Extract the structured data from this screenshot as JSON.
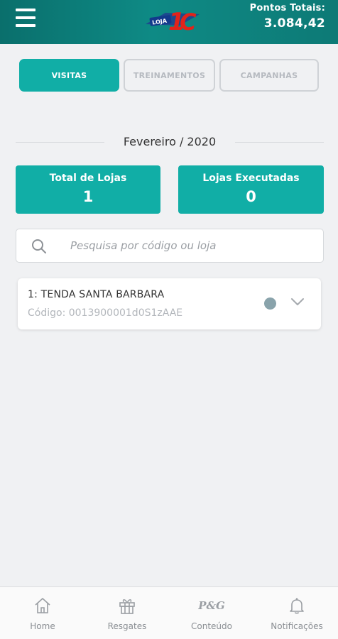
{
  "header": {
    "logo_text": "LOJA 10",
    "points_label": "Pontos Totais:",
    "points_value": "3.084,42"
  },
  "tabs": [
    {
      "label": "VISITAS",
      "active": true
    },
    {
      "label": "TREINAMENTOS",
      "active": false
    },
    {
      "label": "CAMPANHAS",
      "active": false
    }
  ],
  "period": "Fevereiro / 2020",
  "stats": {
    "total_label": "Total de Lojas",
    "total_value": "1",
    "executed_label": "Lojas Executadas",
    "executed_value": "0"
  },
  "search": {
    "placeholder": "Pesquisa por código ou loja",
    "value": ""
  },
  "stores": [
    {
      "name": "1: TENDA SANTA BARBARA",
      "code": "Código: 0013900001d0S1zAAE",
      "status_color": "#89a3ab"
    }
  ],
  "bottom_nav": [
    {
      "label": "Home",
      "icon": "home-icon"
    },
    {
      "label": "Resgates",
      "icon": "gift-icon"
    },
    {
      "label": "Conteúdo",
      "icon": "pg-logo-icon",
      "icon_text": "P&G"
    },
    {
      "label": "Notificações",
      "icon": "bell-icon"
    }
  ],
  "colors": {
    "header": "#0d7a76",
    "accent": "#11aea6",
    "background": "#f0f1f3"
  }
}
